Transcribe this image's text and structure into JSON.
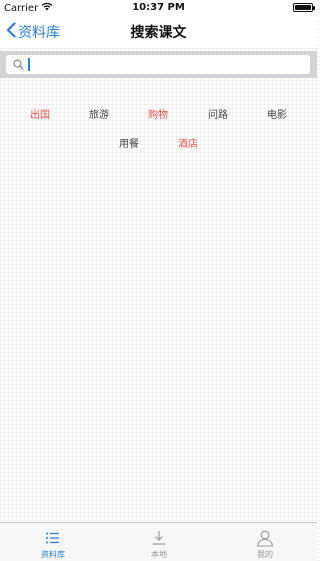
{
  "status_bar": {
    "carrier": "Carrier",
    "time": "10:37 PM"
  },
  "nav": {
    "back_label": "资料库",
    "title": "搜索课文"
  },
  "search": {
    "value": "",
    "placeholder": ""
  },
  "tags": [
    {
      "label": "出国",
      "color": "#e5534b"
    },
    {
      "label": "旅游",
      "color": "#444444"
    },
    {
      "label": "购物",
      "color": "#e5534b"
    },
    {
      "label": "问路",
      "color": "#444444"
    },
    {
      "label": "电影",
      "color": "#444444"
    },
    {
      "label": "用餐",
      "color": "#444444"
    },
    {
      "label": "酒店",
      "color": "#e5534b"
    }
  ],
  "tab_bar": {
    "tabs": [
      {
        "label": "资料库",
        "icon": "list-icon",
        "active": true
      },
      {
        "label": "本地",
        "icon": "download-icon",
        "active": false
      },
      {
        "label": "我的",
        "icon": "user-icon",
        "active": false
      }
    ]
  },
  "colors": {
    "accent": "#2b7fd6",
    "tag_highlight": "#e5534b"
  }
}
